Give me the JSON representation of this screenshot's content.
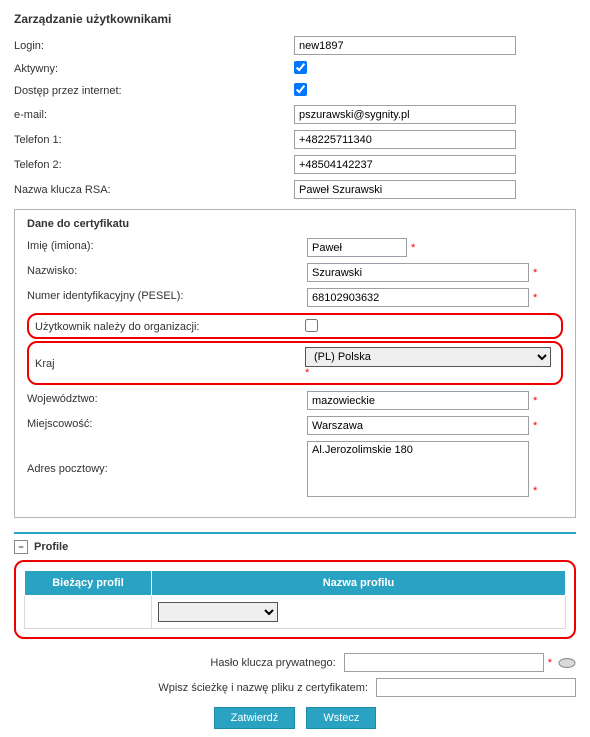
{
  "title": "Zarządzanie użytkownikami",
  "fields": {
    "login": {
      "label": "Login:",
      "value": "new1897"
    },
    "active": {
      "label": "Aktywny:",
      "checked": true
    },
    "internet": {
      "label": "Dostęp przez internet:",
      "checked": true
    },
    "email": {
      "label": "e-mail:",
      "value": "pszurawski@sygnity.pl"
    },
    "phone1": {
      "label": "Telefon 1:",
      "value": "+48225711340"
    },
    "phone2": {
      "label": "Telefon 2:",
      "value": "+48504142237"
    },
    "rsa": {
      "label": "Nazwa klucza RSA:",
      "value": "Paweł Szurawski"
    }
  },
  "cert": {
    "legend": "Dane do certyfikatu",
    "firstname": {
      "label": "Imię (imiona):",
      "value": "Paweł"
    },
    "lastname": {
      "label": "Nazwisko:",
      "value": "Szurawski"
    },
    "pesel": {
      "label": "Numer identyfikacyjny (PESEL):",
      "value": "68102903632"
    },
    "org": {
      "label": "Użytkownik należy do organizacji:",
      "checked": false
    },
    "country": {
      "label": "Kraj",
      "value": "(PL) Polska"
    },
    "region": {
      "label": "Województwo:",
      "value": "mazowieckie"
    },
    "city": {
      "label": "Miejscowość:",
      "value": "Warszawa"
    },
    "address": {
      "label": "Adres pocztowy:",
      "value": "Al.Jerozolimskie 180"
    }
  },
  "profile": {
    "section_label": "Profile",
    "col1": "Bieżący profil",
    "col2": "Nazwa profilu",
    "dropdown_value": ""
  },
  "footer": {
    "password": {
      "label": "Hasło klucza prywatnego:",
      "value": ""
    },
    "path": {
      "label": "Wpisz ścieżkę i nazwę pliku z certyfikatem:",
      "value": ""
    }
  },
  "buttons": {
    "submit": "Zatwierdź",
    "back": "Wstecz"
  }
}
